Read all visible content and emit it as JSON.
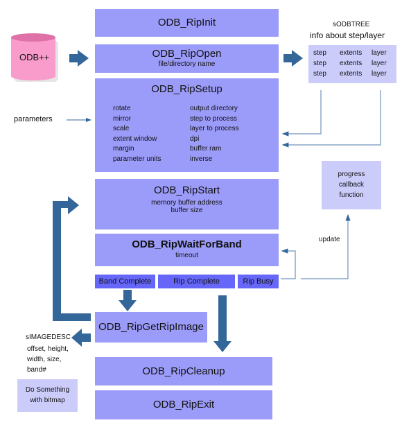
{
  "database": {
    "label": "ODB++"
  },
  "steps": {
    "init": {
      "title": "ODB_RipInit"
    },
    "open": {
      "title": "ODB_RipOpen",
      "sub": "file/directory name"
    },
    "setup": {
      "title": "ODB_RipSetup",
      "params_left": [
        "rotate",
        "mirror",
        "scale",
        "extent window",
        "margin",
        "parameter units"
      ],
      "params_right": [
        "output directory",
        "step to process",
        "layer to process",
        "dpi",
        "buffer ram",
        "inverse"
      ]
    },
    "start": {
      "title": "ODB_RipStart",
      "sub1": "memory buffer address",
      "sub2": "buffer size"
    },
    "wait": {
      "title": "ODB_RipWaitForBand",
      "sub": "timeout"
    },
    "getimage": {
      "title": "ODB_RipGetRipImage"
    },
    "cleanup": {
      "title": "ODB_RipCleanup"
    },
    "exit": {
      "title": "ODB_RipExit"
    }
  },
  "statuses": [
    "Band Complete",
    "Rip Complete",
    "Rip Busy"
  ],
  "tree": {
    "name": "sODBTREE",
    "desc": "info about step/layer",
    "rows": [
      [
        "step",
        "extents",
        "layer"
      ],
      [
        "step",
        "extents",
        "layer"
      ],
      [
        "step",
        "extents",
        "layer"
      ]
    ]
  },
  "parameters_label": "parameters",
  "progress": {
    "lines": [
      "progress",
      "callback",
      "function"
    ]
  },
  "update_label": "update",
  "imagedesc": {
    "name": "sIMAGEDESC",
    "lines": [
      "offset, height,",
      "width, size,",
      "band#"
    ]
  },
  "do_something": {
    "lines": [
      "Do Something",
      "with bitmap"
    ]
  },
  "colors": {
    "box": "#9b9bf9",
    "light": "#ccccfb",
    "status": "#6666f9",
    "arrow": "#336699",
    "db": "#f99ccc"
  }
}
